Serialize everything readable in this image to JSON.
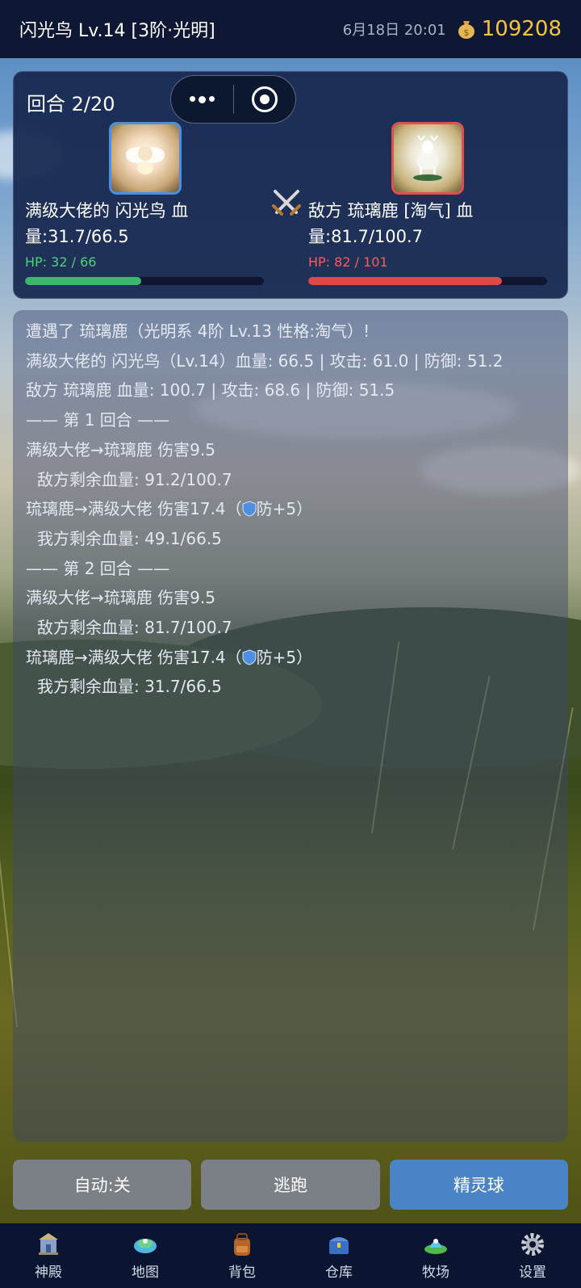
{
  "topbar": {
    "title": "闪光鸟 Lv.14 [3阶·光明]",
    "time": "6月18日 20:01",
    "coins": "109208",
    "coin_icon": "money-bag-icon"
  },
  "battle": {
    "round": "回合 2/20",
    "player": {
      "name_line1": "满级大佬的 闪光鸟  血",
      "name_line2": "量:31.7/66.5",
      "hp_text": "HP: 32 / 66",
      "hp_fraction": 0.485,
      "color": "#3cb86a"
    },
    "enemy": {
      "name_line1": "敌方 琉璃鹿 [淘气] 血",
      "name_line2": "量:81.7/100.7",
      "hp_text": "HP: 82 / 101",
      "hp_fraction": 0.812,
      "color": "#e04848"
    },
    "vs_icon": "crossed-swords-icon"
  },
  "log": [
    "遭遇了 琉璃鹿（光明系 4阶 Lv.13 性格:淘气）!",
    "满级大佬的 闪光鸟（Lv.14）血量: 66.5 | 攻击: 61.0 | 防御: 51.2",
    "敌方 琉璃鹿 血量: 100.7 | 攻击: 68.6 | 防御: 51.5",
    "—— 第 1 回合 ——",
    "满级大佬→琉璃鹿 伤害9.5",
    "敌方剩余血量: 91.2/100.7",
    "琉璃鹿→满级大佬 伤害17.4（",
    "防+5）",
    "我方剩余血量: 49.1/66.5",
    "—— 第 2 回合 ——",
    "满级大佬→琉璃鹿 伤害9.5",
    "敌方剩余血量: 81.7/100.7",
    "琉璃鹿→满级大佬 伤害17.4（",
    "防+5）",
    "我方剩余血量: 31.7/66.5"
  ],
  "actions": {
    "auto": "自动:关",
    "flee": "逃跑",
    "ball": "精灵球"
  },
  "nav": [
    {
      "label": "神殿",
      "icon": "temple-icon"
    },
    {
      "label": "地图",
      "icon": "map-icon"
    },
    {
      "label": "背包",
      "icon": "backpack-icon"
    },
    {
      "label": "仓库",
      "icon": "treasure-chest-icon"
    },
    {
      "label": "牧场",
      "icon": "ranch-icon"
    },
    {
      "label": "设置",
      "icon": "gear-icon"
    }
  ],
  "colors": {
    "accent_blue": "#4a84c4",
    "gold": "#f5c542",
    "hp_green": "#3cb86a",
    "hp_red": "#e04848"
  }
}
